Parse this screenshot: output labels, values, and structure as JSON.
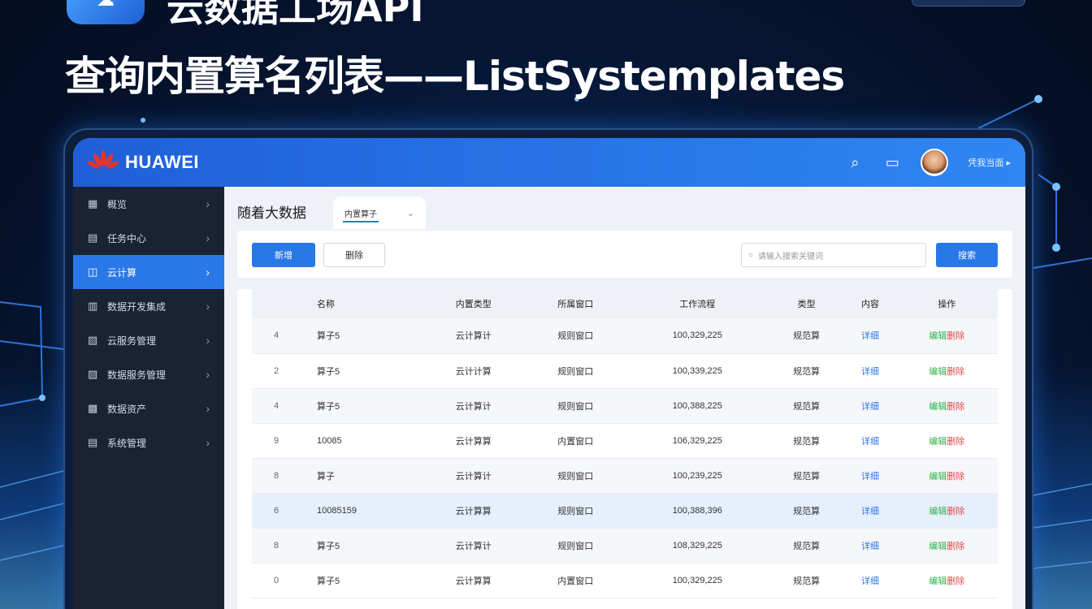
{
  "headline": {
    "line1": "云数据工场API",
    "line2": "查询内置算名列表——ListSystemplates"
  },
  "app": {
    "brand": "HUAWEI",
    "user_name": "凭我当面 ▸",
    "sidebar": [
      {
        "icon": "grid-icon",
        "glyph": "▦",
        "label": "概览"
      },
      {
        "icon": "task-icon",
        "glyph": "▤",
        "label": "任务中心"
      },
      {
        "icon": "cloud-compute-icon",
        "glyph": "◫",
        "label": "云计算",
        "active": true
      },
      {
        "icon": "data-icon",
        "glyph": "▥",
        "label": "数据开发集成"
      },
      {
        "icon": "service-icon",
        "glyph": "▧",
        "label": "云服务管理"
      },
      {
        "icon": "report-icon",
        "glyph": "▨",
        "label": "数据服务管理"
      },
      {
        "icon": "chart-icon",
        "glyph": "▩",
        "label": "数据资产"
      },
      {
        "icon": "settings-icon",
        "glyph": "▤",
        "label": "系统管理"
      }
    ],
    "page_title": "随着大数据",
    "tab_select": "内置算子",
    "toolbar": {
      "primary_button": "新增",
      "secondary_button": "删除",
      "search_placeholder": "请输入搜索关键词",
      "search_button": "搜索"
    },
    "table": {
      "columns": [
        "",
        "名称",
        "内置类型",
        "所属窗口",
        "工作流程",
        "类型",
        "内容",
        "操作"
      ],
      "rows": [
        {
          "idx": "4",
          "name": "算子5",
          "type": "云计算计",
          "window": "规则窗口",
          "flow": "100,329,225",
          "kind": "规范算",
          "content": "详细",
          "op_a": "编辑",
          "op_b": "删除"
        },
        {
          "idx": "2",
          "name": "算子5",
          "type": "云计计算",
          "window": "规则窗口",
          "flow": "100,339,225",
          "kind": "规范算",
          "content": "详细",
          "op_a": "编辑",
          "op_b": "删除"
        },
        {
          "idx": "4",
          "name": "算子5",
          "type": "云计算计",
          "window": "规则窗口",
          "flow": "100,388,225",
          "kind": "规范算",
          "content": "详细",
          "op_a": "编辑",
          "op_b": "删除"
        },
        {
          "idx": "9",
          "name": "10085",
          "type": "云计算算",
          "window": "内置窗口",
          "flow": "106,329,225",
          "kind": "规范算",
          "content": "详细",
          "op_a": "编辑",
          "op_b": "删除"
        },
        {
          "idx": "8",
          "name": "算子",
          "type": "云计算计",
          "window": "规则窗口",
          "flow": "100,239,225",
          "kind": "规范算",
          "content": "详细",
          "op_a": "编辑",
          "op_b": "删除"
        },
        {
          "idx": "6",
          "name": "10085159",
          "type": "云计算算",
          "window": "规则窗口",
          "flow": "100,388,396",
          "kind": "规范算",
          "content": "详细",
          "op_a": "编辑",
          "op_b": "删除",
          "highlight": true
        },
        {
          "idx": "8",
          "name": "算子5",
          "type": "云计算计",
          "window": "规则窗口",
          "flow": "108,329,225",
          "kind": "规范算",
          "content": "详细",
          "op_a": "编辑",
          "op_b": "删除"
        },
        {
          "idx": "0",
          "name": "算子5",
          "type": "云计算算",
          "window": "内置窗口",
          "flow": "100,329,225",
          "kind": "规范算",
          "content": "详细",
          "op_a": "编辑",
          "op_b": "删除"
        }
      ]
    }
  },
  "colors": {
    "accent": "#2a78e8",
    "sidebar_bg": "#1a2233",
    "topbar": "#1f5fd8",
    "op_green": "#2fb24a",
    "op_red": "#e24a4a"
  }
}
